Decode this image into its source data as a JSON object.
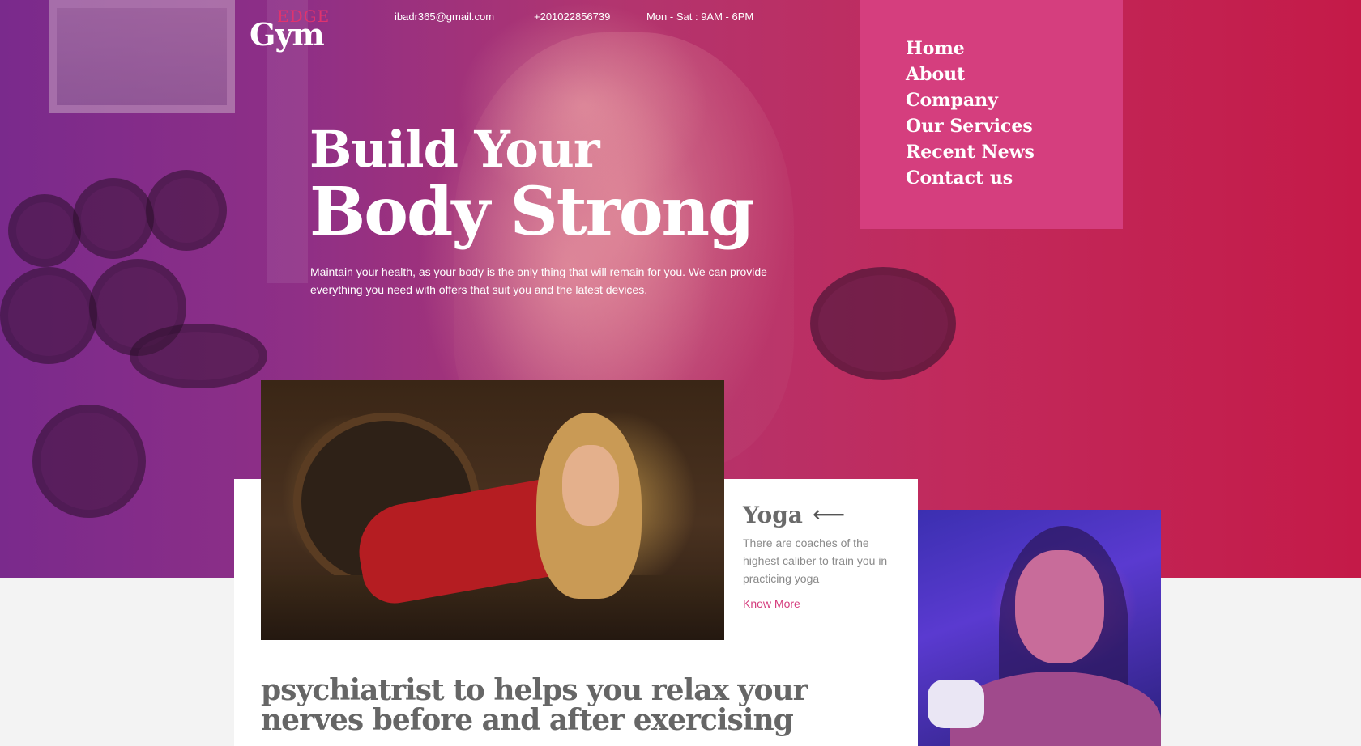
{
  "brand": {
    "edge": "EDGE",
    "gym": "Gym"
  },
  "topbar": {
    "email": "ibadr365@gmail.com",
    "phone": "+201022856739",
    "hours": "Mon - Sat : 9AM - 6PM"
  },
  "nav": {
    "items": [
      {
        "label": "Home"
      },
      {
        "label": "About"
      },
      {
        "label": "Company"
      },
      {
        "label": "Our Services"
      },
      {
        "label": "Recent News"
      },
      {
        "label": "Contact us"
      }
    ]
  },
  "hero": {
    "title_line1": "Build Your",
    "title_line2": "Body Strong",
    "description": "Maintain your health, as your body is the only thing that will remain for you. We can provide everything you need with offers that suit you and the latest devices."
  },
  "card": {
    "title": "Yoga",
    "arrow": "⟵",
    "description": "There are coaches of the highest caliber to train you in practicing yoga",
    "link": "Know More",
    "headline": "psychiatrist to helps you relax your nerves before and after exercising"
  },
  "colors": {
    "accent": "#d53e7e",
    "hero_start": "#7a2a8c",
    "hero_end": "#c41a48",
    "text_grey": "#666666"
  },
  "icons": {
    "arrow": "arrow-left-icon"
  }
}
